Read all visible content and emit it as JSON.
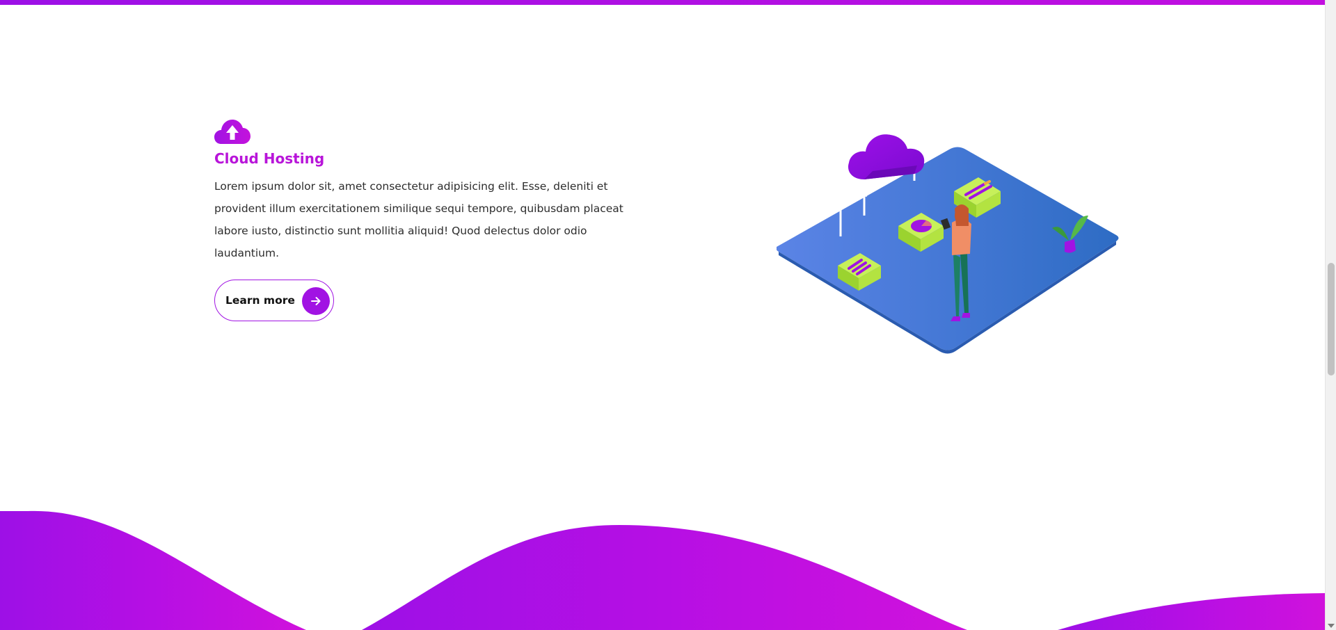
{
  "feature": {
    "icon": "cloud-upload-icon",
    "title": "Cloud Hosting",
    "description": "Lorem ipsum dolor sit, amet consectetur adipisicing elit. Esse, deleniti et provident illum exercitationem similique sequi tempore, quibusdam placeat labore iusto, distinctio sunt mollitia aliquid! Quod delectus dolor odio laudantium.",
    "button_label": "Learn more",
    "button_icon": "arrow-right-icon"
  },
  "illustration": {
    "name": "isometric-cloud-hosting-illustration"
  },
  "colors": {
    "accent": "#a113e3",
    "title": "#b815d9",
    "gradient_start": "#9c10e6",
    "gradient_end": "#d012dc",
    "platform": "#3f74d0"
  }
}
